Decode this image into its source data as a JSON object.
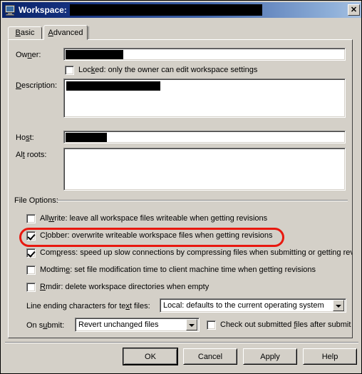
{
  "window": {
    "title": "Workspace:",
    "title_value_redacted": true,
    "icon": "monitor-icon",
    "close_label": "✕"
  },
  "tabs": [
    {
      "label": "Basic",
      "accel": "B",
      "active": false
    },
    {
      "label": "Advanced",
      "accel": "A",
      "active": true
    }
  ],
  "fields": {
    "owner": {
      "label": "Owner:",
      "accel": "n",
      "value": "",
      "redacted": true
    },
    "locked": {
      "label": "Locked: only the owner can edit workspace settings",
      "accel": "k",
      "checked": false
    },
    "description": {
      "label": "Description:",
      "accel": "D",
      "value": "",
      "redacted": true
    },
    "host": {
      "label": "Host:",
      "accel": "s",
      "value": "",
      "redacted": true
    },
    "alt_roots": {
      "label": "Alt roots:",
      "accel": "t",
      "value": ""
    }
  },
  "file_options": {
    "legend": "File Options:",
    "checkboxes": [
      {
        "label": "Allwrite: leave all workspace files writeable when getting revisions",
        "accel": "w",
        "checked": false,
        "highlighted": false
      },
      {
        "label": "Clobber: overwrite writeable workspace files when getting revisions",
        "accel": "l",
        "checked": true,
        "highlighted": true
      },
      {
        "label": "Compress: speed up slow connections by compressing files when submitting or getting rev",
        "accel": "p",
        "checked": true,
        "highlighted": false
      },
      {
        "label": "Modtime: set file modification time to client machine time when getting revisions",
        "accel": "e",
        "checked": false,
        "highlighted": false
      },
      {
        "label": "Rmdir: delete workspace directories when empty",
        "accel": "R",
        "checked": false,
        "highlighted": false
      }
    ]
  },
  "line_ending": {
    "label": "Line ending characters for text files:",
    "accel": "x",
    "value": "Local: defaults to the current operating system"
  },
  "on_submit": {
    "label": "On submit:",
    "accel": "u",
    "value": "Revert unchanged files"
  },
  "checkout_after_submit": {
    "label": "Check out submitted files after submit",
    "accel": "f",
    "checked": false
  },
  "buttons": {
    "ok": "OK",
    "cancel": "Cancel",
    "apply": "Apply",
    "help": "Help"
  },
  "annotation": {
    "color": "#e8180f",
    "targets": "clobber-checkbox-row"
  }
}
